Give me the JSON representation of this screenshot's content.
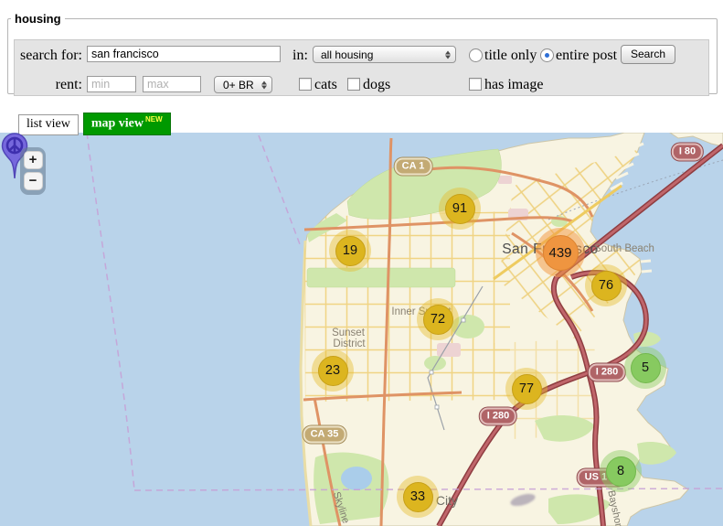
{
  "form": {
    "legend": "housing",
    "search_label": "search for:",
    "search_value": "san francisco",
    "in_label": "in:",
    "category_value": "all housing",
    "title_only_label": "title only",
    "entire_post_label": "entire post",
    "search_button_label": "Search",
    "rent_label": "rent:",
    "min_placeholder": "min",
    "max_placeholder": "max",
    "bedrooms_value": "0+ BR",
    "cats_label": "cats",
    "dogs_label": "dogs",
    "has_image_label": "has image"
  },
  "tabs": {
    "list_label": "list view",
    "map_label": "map view",
    "map_badge": "NEW"
  },
  "map": {
    "zoom_in_label": "+",
    "zoom_out_label": "−",
    "clusters": [
      {
        "count": "91",
        "color": "yellow"
      },
      {
        "count": "19",
        "color": "yellow"
      },
      {
        "count": "439",
        "color": "orange"
      },
      {
        "count": "76",
        "color": "yellow"
      },
      {
        "count": "72",
        "color": "yellow"
      },
      {
        "count": "23",
        "color": "yellow"
      },
      {
        "count": "77",
        "color": "yellow"
      },
      {
        "count": "5",
        "color": "green"
      },
      {
        "count": "33",
        "color": "yellow"
      },
      {
        "count": "8",
        "color": "green"
      }
    ],
    "shields": [
      {
        "text": "CA 1",
        "type": "state"
      },
      {
        "text": "I 80",
        "type": "interstate"
      },
      {
        "text": "I 280",
        "type": "interstate"
      },
      {
        "text": "I 280",
        "type": "interstate"
      },
      {
        "text": "CA 35",
        "type": "state"
      },
      {
        "text": "US 101",
        "type": "interstate"
      }
    ],
    "labels": [
      {
        "text": "San Francisco"
      },
      {
        "text": "South Beach"
      },
      {
        "text": "Inner Sunset"
      },
      {
        "text": "Sunset"
      },
      {
        "text": "District"
      },
      {
        "text": "Daly City"
      },
      {
        "text": "Skyline"
      },
      {
        "text": "Bayshore"
      }
    ],
    "colors": {
      "water": "#b9d3ea",
      "land": "#f8f4e2",
      "park": "#cfe7ac",
      "cluster_yellow": "#dcb51f",
      "cluster_orange": "#ef9540",
      "cluster_green": "#87ca60",
      "pin_purple": "#7668dd",
      "freeway": "#b0545a",
      "tab_green": "#009900"
    }
  }
}
